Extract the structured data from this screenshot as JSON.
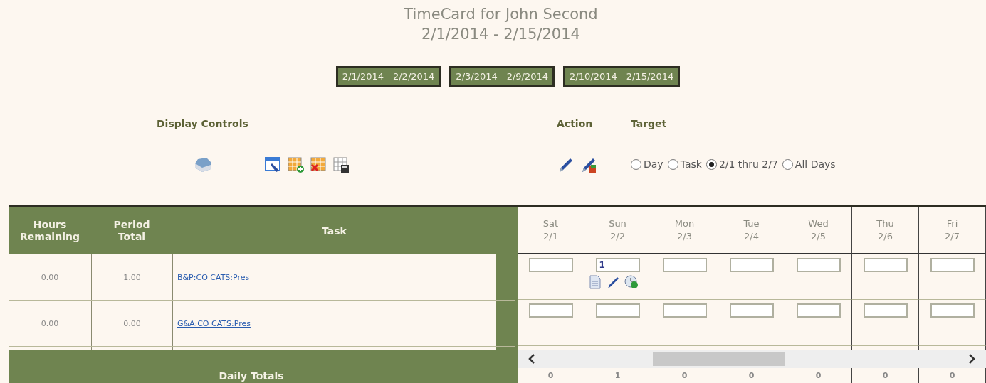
{
  "title": "TimeCard for John Second",
  "period": "2/1/2014 - 2/15/2014",
  "week_buttons": [
    "2/1/2014 - 2/2/2014",
    "2/3/2014 - 2/9/2014",
    "2/10/2014 - 2/15/2014"
  ],
  "display_controls": {
    "label": "Display Controls"
  },
  "action": {
    "label": "Action"
  },
  "target": {
    "label": "Target",
    "options": [
      {
        "label": "Day",
        "selected": false
      },
      {
        "label": "Task",
        "selected": false
      },
      {
        "label": "2/1 thru 2/7",
        "selected": true
      },
      {
        "label": "All Days",
        "selected": false
      }
    ]
  },
  "table": {
    "columns": [
      "Hours Remaining",
      "Period Total",
      "Task"
    ],
    "days": [
      {
        "day": "Sat",
        "date": "2/1"
      },
      {
        "day": "Sun",
        "date": "2/2"
      },
      {
        "day": "Mon",
        "date": "2/3"
      },
      {
        "day": "Tue",
        "date": "2/4"
      },
      {
        "day": "Wed",
        "date": "2/5"
      },
      {
        "day": "Thu",
        "date": "2/6"
      },
      {
        "day": "Fri",
        "date": "2/7"
      }
    ],
    "rows": [
      {
        "hours_remaining": "0.00",
        "period_total": "1.00",
        "task": "B&P:CO CATS:Pres",
        "entries": [
          {
            "tools": false
          },
          {
            "value": "1",
            "tools": true
          },
          {
            "tools": false
          },
          {
            "tools": false
          },
          {
            "tools": false
          },
          {
            "tools": false
          },
          {
            "tools": false
          }
        ]
      },
      {
        "hours_remaining": "0.00",
        "period_total": "0.00",
        "task": "G&A:CO CATS:Pres",
        "entries": [
          {
            "tools": false
          },
          {
            "tools": false
          },
          {
            "tools": false
          },
          {
            "tools": false
          },
          {
            "tools": false
          },
          {
            "tools": false
          },
          {
            "tools": false
          }
        ]
      }
    ],
    "totals_label": "Daily Totals",
    "totals": [
      "0",
      "1",
      "0",
      "0",
      "0",
      "0",
      "0"
    ]
  }
}
